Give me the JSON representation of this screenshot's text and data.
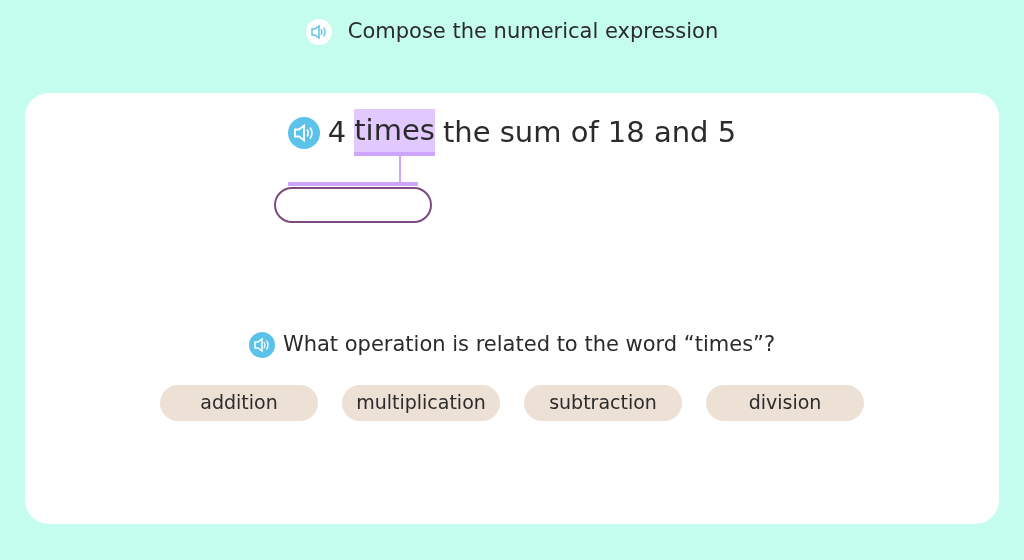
{
  "header": {
    "title": "Compose the numerical expression"
  },
  "expression": {
    "tokens": [
      {
        "text": "4",
        "highlighted": false
      },
      {
        "text": "times",
        "highlighted": true
      },
      {
        "text": "the sum of 18 and 5",
        "highlighted": false
      }
    ]
  },
  "question": {
    "text": "What operation is related to the word “times”?"
  },
  "options": [
    {
      "label": "addition",
      "selected": false
    },
    {
      "label": "multiplication",
      "selected": false
    },
    {
      "label": "subtraction",
      "selected": false
    },
    {
      "label": "division",
      "selected": false
    }
  ]
}
